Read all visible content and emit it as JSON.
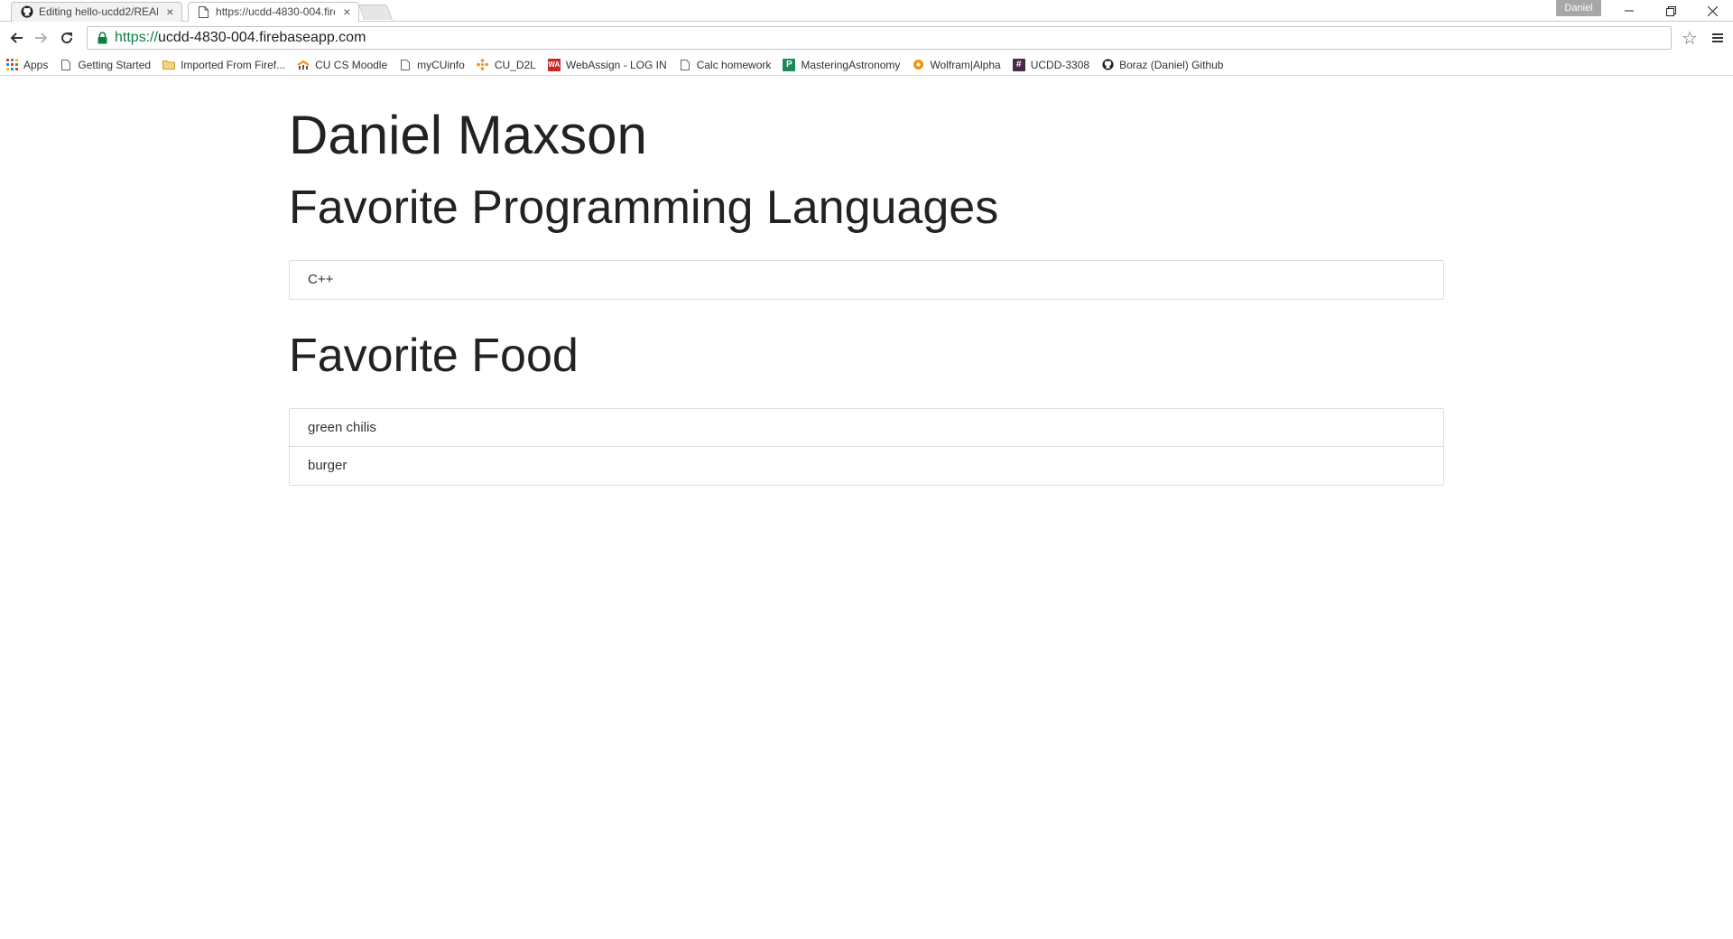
{
  "browser": {
    "tabs": [
      {
        "title": "Editing hello-ucdd2/READ",
        "icon": "github-icon",
        "active": false
      },
      {
        "title": "https://ucdd-4830-004.fire",
        "icon": "page-icon",
        "active": true
      }
    ],
    "profile_name": "Daniel",
    "url_scheme": "https://",
    "url_host": "ucdd-4830-004.firebaseapp.com",
    "bookmarks": [
      {
        "label": "Apps",
        "icon": "apps-grid-icon"
      },
      {
        "label": "Getting Started",
        "icon": "page-icon"
      },
      {
        "label": "Imported From Firef...",
        "icon": "folder-icon"
      },
      {
        "label": "CU CS Moodle",
        "icon": "moodle-icon"
      },
      {
        "label": "myCUinfo",
        "icon": "page-icon"
      },
      {
        "label": "CU_D2L",
        "icon": "d2l-icon"
      },
      {
        "label": "WebAssign - LOG IN",
        "icon": "webassign-icon"
      },
      {
        "label": "Calc homework",
        "icon": "page-icon"
      },
      {
        "label": "MasteringAstronomy",
        "icon": "mastering-icon"
      },
      {
        "label": "Wolfram|Alpha",
        "icon": "wolfram-icon"
      },
      {
        "label": "UCDD-3308",
        "icon": "slack-icon"
      },
      {
        "label": "Boraz (Daniel) Github",
        "icon": "github-icon"
      }
    ]
  },
  "page": {
    "title": "Daniel Maxson",
    "languages_heading": "Favorite Programming Languages",
    "languages": [
      "C++"
    ],
    "food_heading": "Favorite Food",
    "foods": [
      "green chilis",
      "burger"
    ]
  },
  "colors": {
    "secure_green": "#0b8043",
    "border": "#dddddd"
  }
}
